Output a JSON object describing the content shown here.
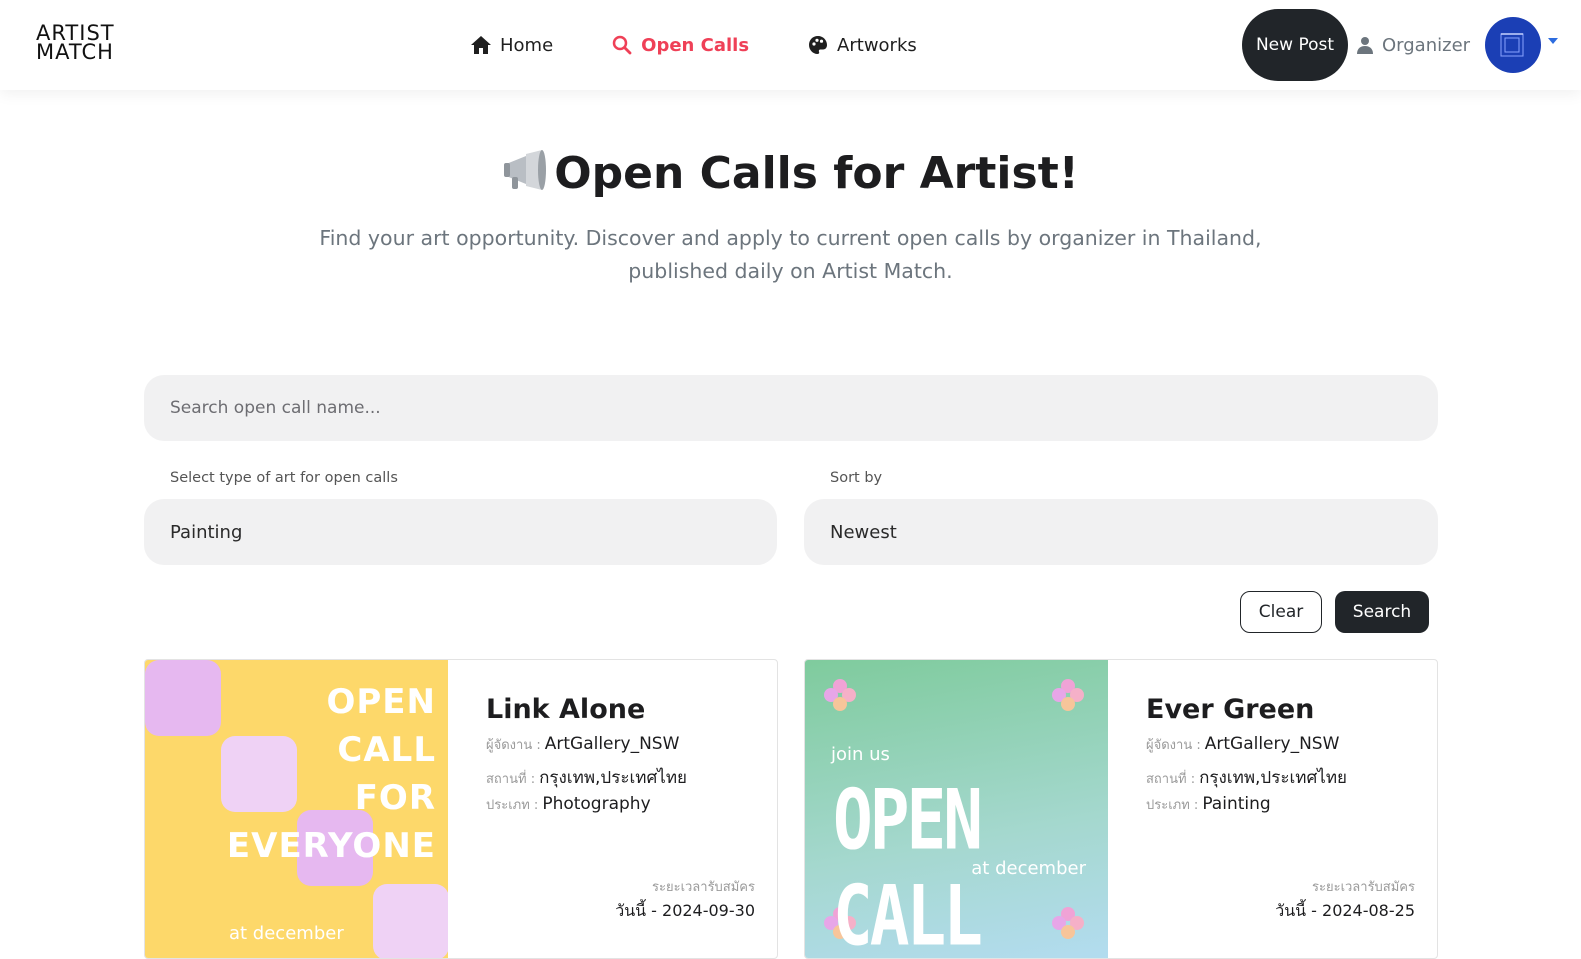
{
  "brand": {
    "logo_line1": "ARTIST",
    "logo_line2": "MATCH"
  },
  "nav": {
    "home": "Home",
    "open_calls": "Open Calls",
    "artworks": "Artworks",
    "new_post": "New Post",
    "organizer": "Organizer",
    "active_color": "#ef4057"
  },
  "hero": {
    "title": "Open Calls for Artist!",
    "subtitle": "Find your art opportunity. Discover and apply to current open calls by organizer in Thailand, published daily on Artist Match."
  },
  "search": {
    "placeholder": "Search open call name...",
    "type_label": "Select type of art for open calls",
    "type_value": "Painting",
    "sort_label": "Sort by",
    "sort_value": "Newest",
    "clear": "Clear",
    "submit": "Search"
  },
  "labels": {
    "organizer": "ผู้จัดงาน :",
    "location": "สถานที่ :",
    "type": "ประเภท :",
    "period": "ระยะเวลารับสมัคร"
  },
  "cards": [
    {
      "title": "Link Alone",
      "organizer": "ArtGallery_NSW",
      "location": "กรุงเทพ,ประเทศไทย",
      "type": "Photography",
      "period": "วันนี้ - 2024-09-30",
      "poster": {
        "lines": [
          "OPEN",
          "CALL",
          "FOR",
          "EVERYONE"
        ],
        "footer": "at december"
      }
    },
    {
      "title": "Ever Green",
      "organizer": "ArtGallery_NSW",
      "location": "กรุงเทพ,ประเทศไทย",
      "type": "Painting",
      "period": "วันนี้ - 2024-08-25",
      "poster": {
        "top": "join us",
        "big": "OPEN CALL",
        "footer": "at december"
      }
    }
  ]
}
